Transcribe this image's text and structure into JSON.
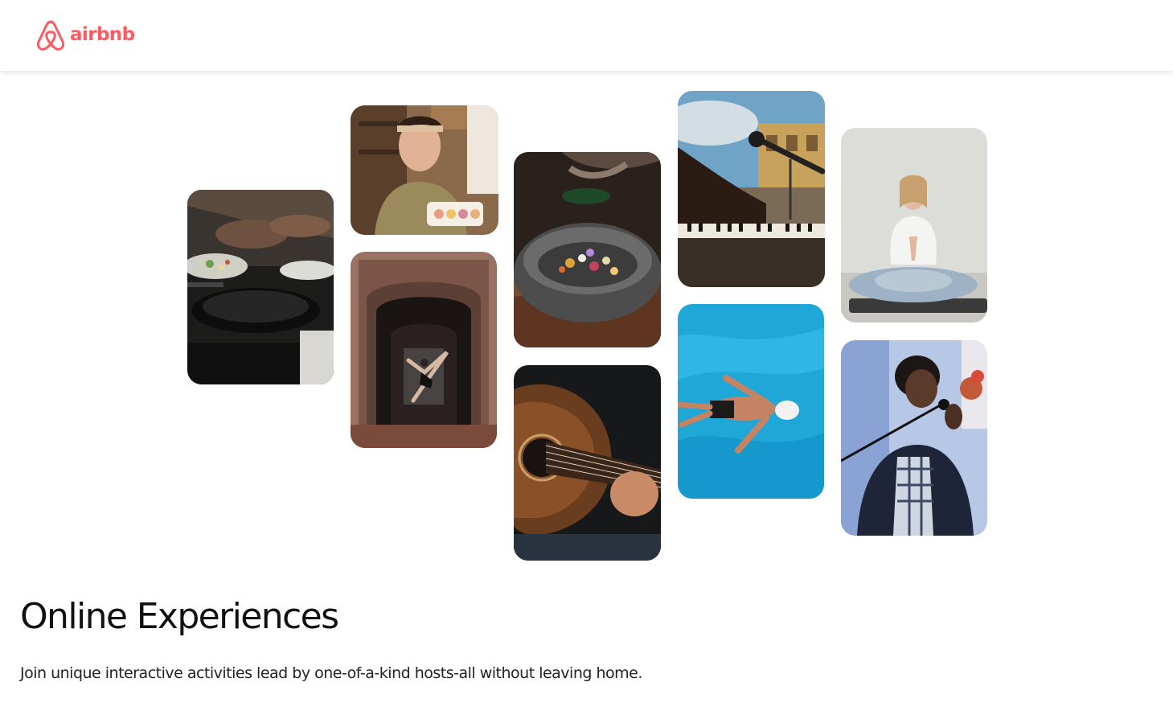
{
  "navbar": {
    "logo_text": "airbnb",
    "logo_icon": "airbnb-belo-icon",
    "brand_color": "#FF5A5F"
  },
  "photo_grid": {
    "tiles": [
      {
        "subject": "hands-cooking-pans"
      },
      {
        "subject": "woman-holding-macarons"
      },
      {
        "subject": "dancer-in-archway"
      },
      {
        "subject": "seasoning-food-bowl"
      },
      {
        "subject": "acoustic-guitar-closeup"
      },
      {
        "subject": "hands-on-keyboard-with-microphone"
      },
      {
        "subject": "swimmer-in-pool"
      },
      {
        "subject": "woman-meditating-yoga"
      },
      {
        "subject": "singer-with-microphone"
      }
    ]
  },
  "hero": {
    "title": "Online Experiences",
    "subtitle": "Join unique interactive activities lead by one-of-a-kind hosts-all without leaving home."
  }
}
